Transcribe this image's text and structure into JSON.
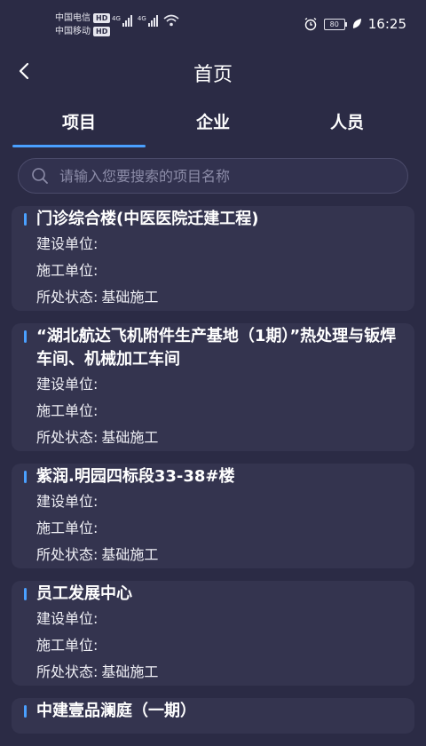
{
  "status_bar": {
    "carrier1": "中国电信",
    "carrier2": "中国移动",
    "hd": "HD",
    "net1": "4G",
    "net2": "4G",
    "battery": "80",
    "time": "16:25"
  },
  "nav": {
    "title": "首页",
    "back_icon": "chevron-left-icon"
  },
  "tabs": [
    {
      "label": "项目",
      "active": true
    },
    {
      "label": "企业",
      "active": false
    },
    {
      "label": "人员",
      "active": false
    }
  ],
  "search": {
    "placeholder": "请输入您要搜索的项目名称",
    "value": ""
  },
  "labels": {
    "build_unit": "建设单位:",
    "construct_unit": "施工单位:",
    "status": "所处状态:"
  },
  "projects": [
    {
      "name": "门诊综合楼(中医医院迁建工程)",
      "build_unit": "",
      "construct_unit": "",
      "status": "基础施工"
    },
    {
      "name": "“湖北航达飞机附件生产基地（1期）”热处理与钣焊车间、机械加工车间",
      "build_unit": "",
      "construct_unit": "",
      "status": "基础施工"
    },
    {
      "name": "紫润.明园四标段33-38#楼",
      "build_unit": "",
      "construct_unit": "",
      "status": "基础施工"
    },
    {
      "name": "员工发展中心",
      "build_unit": "",
      "construct_unit": "",
      "status": "基础施工"
    },
    {
      "name": "中建壹品澜庭（一期）",
      "build_unit": "",
      "construct_unit": "",
      "status": ""
    }
  ],
  "colors": {
    "background": "#2b2b45",
    "card": "#34344f",
    "accent": "#4aa0ff"
  }
}
